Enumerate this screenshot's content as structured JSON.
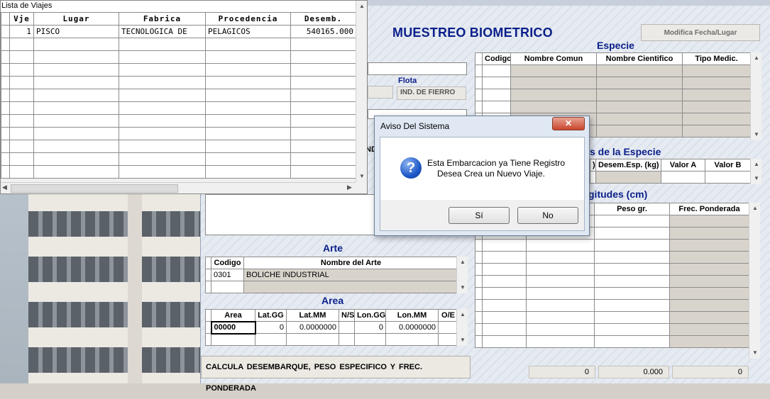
{
  "lista": {
    "title": "Lista de Viajes",
    "headers": [
      "Vje",
      "Lugar",
      "Fabrica",
      "Procedencia",
      "Desemb."
    ],
    "rows": [
      [
        "1",
        "PISCO",
        "TECNOLOGICA DE",
        "PELAGICOS",
        "540165.000"
      ]
    ]
  },
  "main": {
    "title": "MUESTREO BIOMETRICO",
    "modifica_button": "Modifica Fecha/Lugar",
    "flota_label": "Flota",
    "flota_value": "IND. DE FIERRO",
    "especie": {
      "title": "Especie",
      "headers": [
        "Codigo",
        "Nombre Comun",
        "Nombre Cientifico",
        "Tipo Medic."
      ]
    },
    "desembarque": {
      "title_partial": "s de la Especie",
      "headers_partial": [
        ")",
        "Desem.Esp. (kg)",
        "Valor A",
        "Valor B"
      ],
      "partial_left_header": "ND"
    },
    "longitudes": {
      "title_partial": "gitudes (cm)",
      "headers": [
        "Peso gr.",
        "Frec. Ponderada"
      ],
      "totals": [
        "0",
        "0.000",
        "0"
      ]
    },
    "arte": {
      "title": "Arte",
      "headers": [
        "Codigo",
        "Nombre del Arte"
      ],
      "rows": [
        [
          "0301",
          "BOLICHE INDUSTRIAL"
        ]
      ]
    },
    "area": {
      "title": "Area",
      "headers": [
        "Area",
        "Lat.GG",
        "Lat.MM",
        "N/S",
        "Lon.GG",
        "Lon.MM",
        "O/E"
      ],
      "rows": [
        [
          "00000",
          "0",
          "0.0000000",
          "",
          "0",
          "0.0000000",
          ""
        ]
      ]
    },
    "calcula_button": "CALCULA DESEMBARQUE, PESO ESPECIFICO Y FREC. PONDERADA"
  },
  "dialog": {
    "title": "Aviso Del Sistema",
    "line1": "Esta Embarcacion ya Tiene Registro",
    "line2": "Desea Crea un Nuevo Viaje.",
    "yes_label": "Sí",
    "no_label": "No",
    "close_glyph": "✕",
    "icon": "question-icon"
  }
}
